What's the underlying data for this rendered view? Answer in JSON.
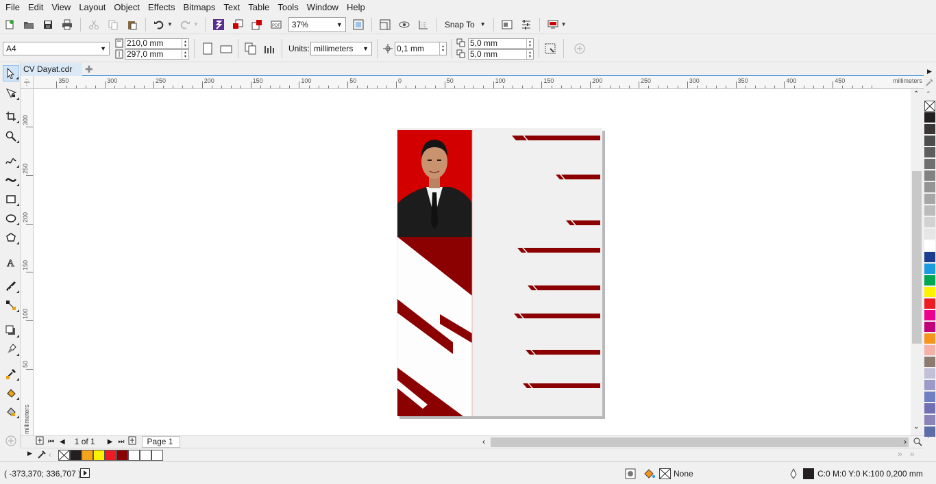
{
  "menu": [
    "File",
    "Edit",
    "View",
    "Layout",
    "Object",
    "Effects",
    "Bitmaps",
    "Text",
    "Table",
    "Tools",
    "Window",
    "Help"
  ],
  "toolbar": {
    "zoom": "37%",
    "snap_to": "Snap To",
    "icons": [
      "new-icon",
      "open-icon",
      "save-icon",
      "print-icon",
      "cut-icon",
      "copy-icon",
      "paste-icon",
      "undo-icon",
      "redo-icon",
      "search-content-icon",
      "import-icon",
      "export-icon",
      "publish-pdf-icon",
      "zoom-box-icon",
      "full-screen-preview-icon",
      "show-rulers-icon",
      "show-grid-icon",
      "options-icon",
      "launch-icon"
    ]
  },
  "propbar": {
    "page_size": "A4",
    "width": "210,0 mm",
    "height": "297,0 mm",
    "units_label": "Units:",
    "units_value": "millimeters",
    "nudge": "0,1 mm",
    "dup_x": "5,0 mm",
    "dup_y": "5,0 mm"
  },
  "document": {
    "tab_title": "CV Dayat.cdr",
    "page_counter": "1 of 1",
    "page_tab": "Page 1"
  },
  "rulers": {
    "unit_label": "millimeters",
    "h_labels": [
      "350",
      "300",
      "250",
      "200",
      "150",
      "100",
      "50",
      "0",
      "50",
      "100",
      "150",
      "200",
      "250",
      "300",
      "350",
      "400",
      "450"
    ],
    "v_labels": [
      "300",
      "250",
      "200",
      "150",
      "100",
      "50"
    ]
  },
  "palette_colors": [
    "#231f20",
    "#3b3536",
    "#4d4d4d",
    "#5e5e5e",
    "#707070",
    "#828282",
    "#949494",
    "#a7a7a7",
    "#bcbcbc",
    "#d2d2d2",
    "#e6e6e6",
    "#ffffff",
    "#1b3d8f",
    "#1a9be0",
    "#00a651",
    "#fff200",
    "#ed1c24",
    "#ec008c",
    "#c2007a",
    "#f7941d",
    "#f5b0a8",
    "#8d7b6f",
    "#c2c0d8",
    "#9c9ac8",
    "#6e7fc2",
    "#7170b4",
    "#8a84b8",
    "#5c6da8"
  ],
  "doc_palette": [
    "#231f20",
    "#f7a21b",
    "#fff200",
    "#ed1c24",
    "#8b0000",
    "#ffffff",
    "#ffffff",
    "#ffffff"
  ],
  "status": {
    "coords": "( -373,370; 336,707 )",
    "fill": "None",
    "outline": "C:0 M:0 Y:0 K:100  0,200 mm"
  },
  "colors": {
    "accent": "#3d8ed8",
    "design_red": "#8b0000",
    "photo_bg": "#d30000",
    "page_bg": "#f0f0f0"
  }
}
